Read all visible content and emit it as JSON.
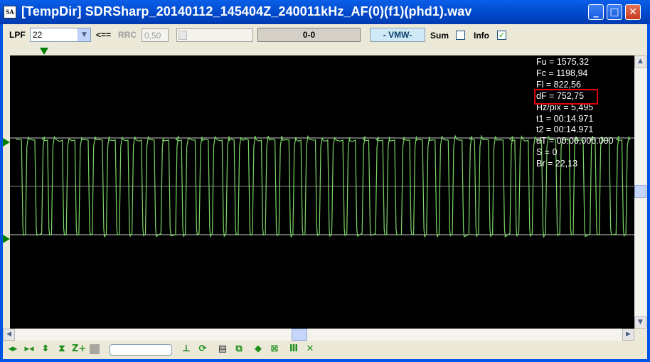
{
  "window": {
    "icon_label": "SA",
    "title": "[TempDir] SDRSharp_20140112_145404Z_240011kHz_AF(0)(f1)(phd1).wav",
    "minimize_symbol": "_",
    "maximize_symbol": "□",
    "close_symbol": "✕"
  },
  "toolbar": {
    "lpf_label": "LPF",
    "lpf_value": "22",
    "arrow_label": "<==",
    "rrc_label": "RRC",
    "rrc_value": "0,50",
    "range_value": "0-0",
    "mode_value": "- VMW-",
    "sum_label": "Sum",
    "sum_checked": "",
    "info_label": "Info",
    "info_checked": "✓"
  },
  "info": {
    "fu": "Fu = 1575,32",
    "fc": "Fc = 1198,94",
    "fl": "Fl = 822,56",
    "df": "dF = 752,75",
    "hzpix": "Hz/pix = 5,495",
    "t1": "t1 = 00:14.971",
    "t2": "t2 = 00:14.971",
    "dt": "dT = 00:00,000.000",
    "s": "S = 0",
    "br": "Br = 22,13"
  },
  "colors": {
    "plot_background": "#000000",
    "waveform": "#7cd867",
    "guide_lines": "#c8c8c8",
    "highlight_box": "#e00000"
  },
  "chart_data": {
    "type": "line",
    "title": "",
    "xlabel": "",
    "ylabel": "",
    "ylim": [
      822.56,
      1575.32
    ],
    "levels": {
      "upper": 1575.32,
      "center": 1198.94,
      "lower": 822.56
    },
    "pulse_count": 46
  },
  "bottom": {
    "text_field_value": ""
  }
}
